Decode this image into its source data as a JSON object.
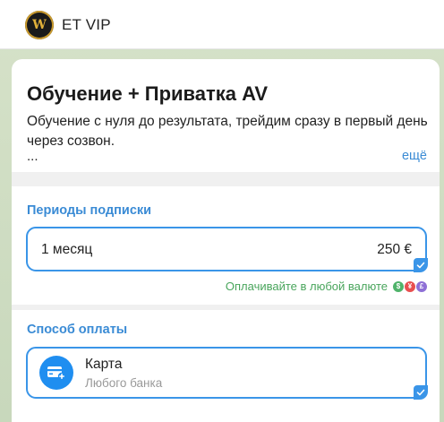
{
  "header": {
    "title": "ET VIP",
    "avatar_icon": "brand-logo-icon",
    "avatar_letter": "W"
  },
  "product": {
    "title": "Обучение + Приватка AV",
    "description": "Обучение с нуля до результата, трейдим сразу в первый день через созвон.",
    "ellipsis": "...",
    "more_label": "ещё"
  },
  "periods": {
    "section_title": "Периоды подписки",
    "options": [
      {
        "label": "1 месяц",
        "price": "250 €",
        "selected": true
      }
    ],
    "currency_note": "Оплачивайте в любой валюте",
    "currency_icons": [
      {
        "symbol": "$",
        "color": "#4fb36a"
      },
      {
        "symbol": "¥",
        "color": "#e84f4f"
      },
      {
        "symbol": "£",
        "color": "#8e6fd6"
      }
    ]
  },
  "payment": {
    "section_title": "Способ оплаты",
    "options": [
      {
        "label": "Карта",
        "sublabel": "Любого банка",
        "icon": "card-add-icon",
        "selected": true
      }
    ]
  },
  "colors": {
    "accent": "#3a95e8",
    "link": "#3a8bd5",
    "success": "#49a55c"
  }
}
